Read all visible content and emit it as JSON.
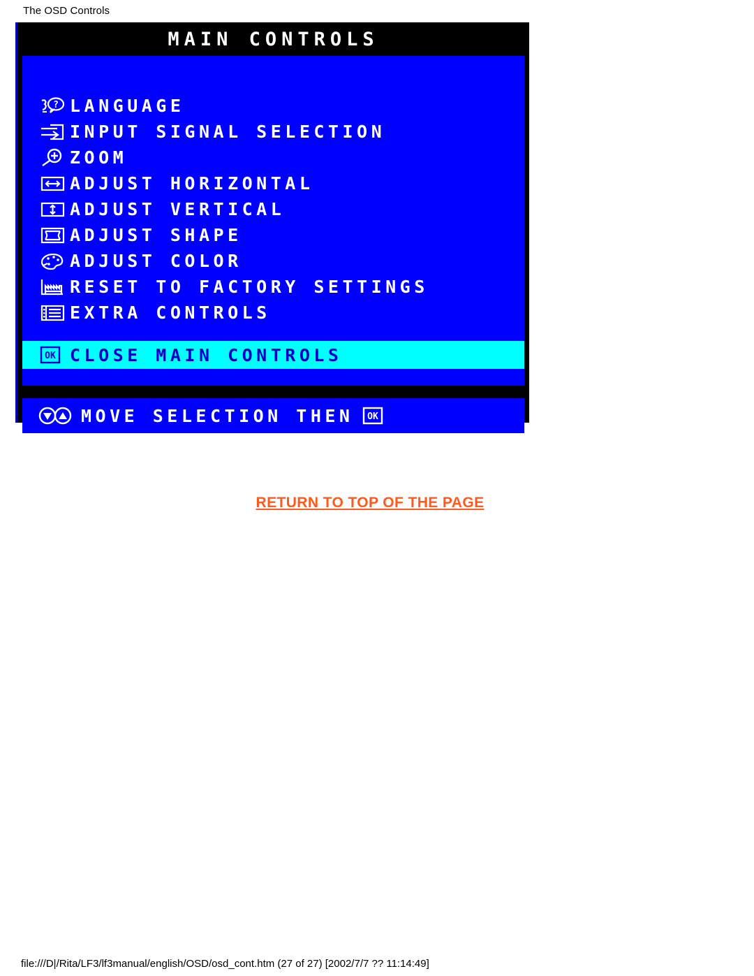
{
  "page": {
    "heading": "The OSD Controls",
    "return_link_label": "RETURN TO TOP OF THE PAGE",
    "footer_path": "file:///D|/Rita/LF3/lf3manual/english/OSD/osd_cont.htm (27 of 27) [2002/7/7 ?? 11:14:49]",
    "link_color": "#ff5a1e"
  },
  "osd": {
    "title": "MAIN CONTROLS",
    "colors": {
      "background": "#0000ff",
      "titlebar": "#000000",
      "highlight": "#00ffff",
      "text": "#ffffff",
      "highlight_text": "#0000cc"
    },
    "menu_items": [
      {
        "label": "LANGUAGE",
        "icon": "speech-bubble-question-icon"
      },
      {
        "label": "INPUT SIGNAL SELECTION",
        "icon": "arrow-into-box-icon"
      },
      {
        "label": "ZOOM",
        "icon": "magnifier-plus-icon"
      },
      {
        "label": "ADJUST HORIZONTAL",
        "icon": "horizontal-arrows-box-icon"
      },
      {
        "label": "ADJUST VERTICAL",
        "icon": "vertical-arrows-box-icon"
      },
      {
        "label": "ADJUST SHAPE",
        "icon": "pincushion-box-icon"
      },
      {
        "label": "ADJUST COLOR",
        "icon": "color-palette-icon"
      },
      {
        "label": "RESET TO FACTORY SETTINGS",
        "icon": "factory-icon"
      },
      {
        "label": "EXTRA CONTROLS",
        "icon": "list-document-icon"
      }
    ],
    "close_item": {
      "label": "CLOSE MAIN CONTROLS",
      "icon": "ok-button-icon"
    },
    "hint_bar": {
      "label": "MOVE SELECTION THEN",
      "icons": [
        "down-arrow-circle-icon",
        "up-arrow-circle-icon",
        "ok-button-icon"
      ]
    }
  }
}
